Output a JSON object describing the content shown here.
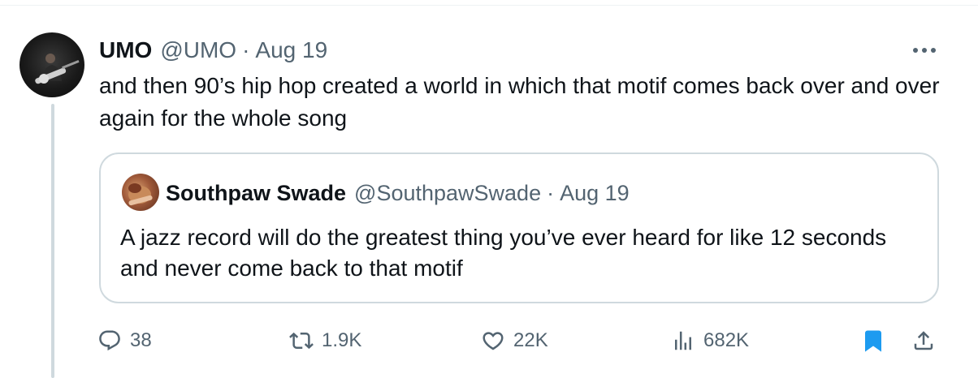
{
  "tweet": {
    "author_name": "UMO",
    "author_handle": "@UMO",
    "separator": "·",
    "date": "Aug 19",
    "text": "and then 90’s hip hop created a world in which that motif comes back over and over again for the whole song",
    "more_icon": "more-horizontal-icon"
  },
  "quote": {
    "author_name": "Southpaw Swade",
    "author_handle": "@SouthpawSwade",
    "separator": "·",
    "date": "Aug 19",
    "text": "A jazz record will do the greatest thing you’ve ever heard for like 12 seconds and never come back to that motif"
  },
  "actions": {
    "replies": "38",
    "retweets": "1.9K",
    "likes": "22K",
    "views": "682K",
    "bookmark_icon": "bookmark-icon",
    "share_icon": "share-icon"
  },
  "colors": {
    "text": "#0f1419",
    "secondary": "#536471",
    "border": "#cfd9de",
    "accent": "#1d9bf0"
  }
}
